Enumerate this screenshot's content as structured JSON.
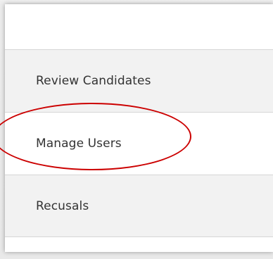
{
  "menu": {
    "items": [
      {
        "label": "Review Candidates"
      },
      {
        "label": "Manage Users"
      },
      {
        "label": "Recusals"
      }
    ]
  },
  "annotation": {
    "color": "#cc0000",
    "target": "Manage Users"
  },
  "colors": {
    "item_shaded": "#f2f2f2",
    "item_plain": "#ffffff",
    "text": "#333333",
    "divider": "#d6d6d6"
  }
}
